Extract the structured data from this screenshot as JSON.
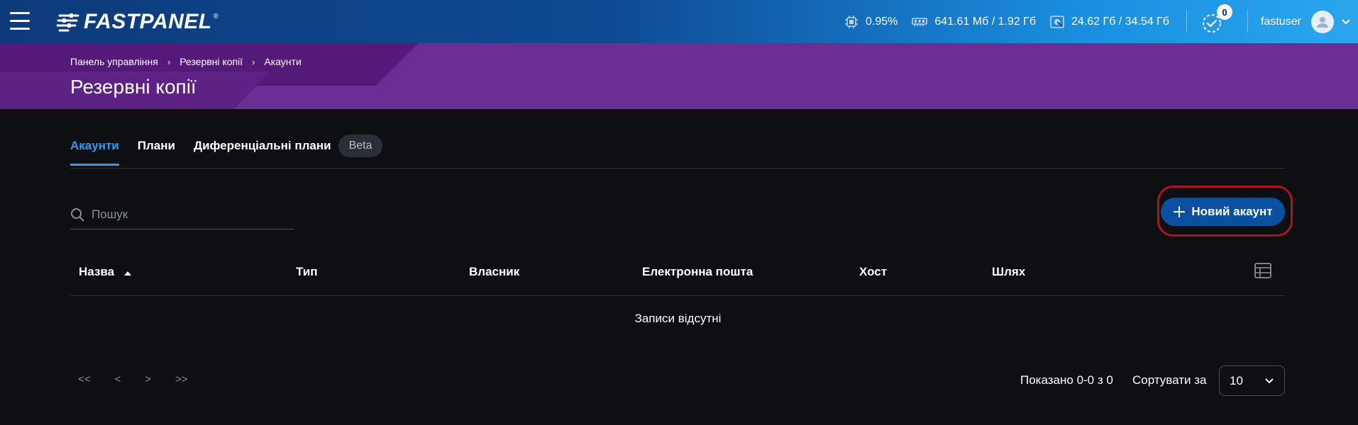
{
  "brand": {
    "name": "FASTPANEL",
    "reg": "®"
  },
  "stats": {
    "cpu": "0.95%",
    "memory": "641.61 Мб / 1.92 Гб",
    "disk": "24.62 Гб / 34.54 Гб"
  },
  "notifications": {
    "count": "0"
  },
  "user": {
    "name": "fastuser"
  },
  "breadcrumb": [
    "Панель управління",
    "Резервні копії",
    "Акаунти"
  ],
  "page": {
    "title": "Резервні копії"
  },
  "tabs": [
    {
      "label": "Акаунти",
      "active": true
    },
    {
      "label": "Плани",
      "active": false
    },
    {
      "label": "Диференціальні плани",
      "active": false
    }
  ],
  "tab_badge": "Beta",
  "search": {
    "placeholder": "Пошук",
    "value": ""
  },
  "new_button": {
    "label": "Новий акаунт"
  },
  "table": {
    "columns": [
      "Назва",
      "Тип",
      "Власник",
      "Електронна пошта",
      "Хост",
      "Шлях"
    ],
    "sort": {
      "column": "Назва",
      "direction": "asc"
    },
    "empty_text": "Записи відсутні"
  },
  "pagination": {
    "first": "<<",
    "prev": "<",
    "next": ">",
    "last": ">>",
    "shown": "Показано 0-0 з 0",
    "sort_label": "Сортувати за",
    "page_size": "10"
  },
  "colors": {
    "accent": "#2e9bf0",
    "button": "#0b4fa0",
    "banner": "#6a2e94",
    "highlight": "#b0121e"
  }
}
